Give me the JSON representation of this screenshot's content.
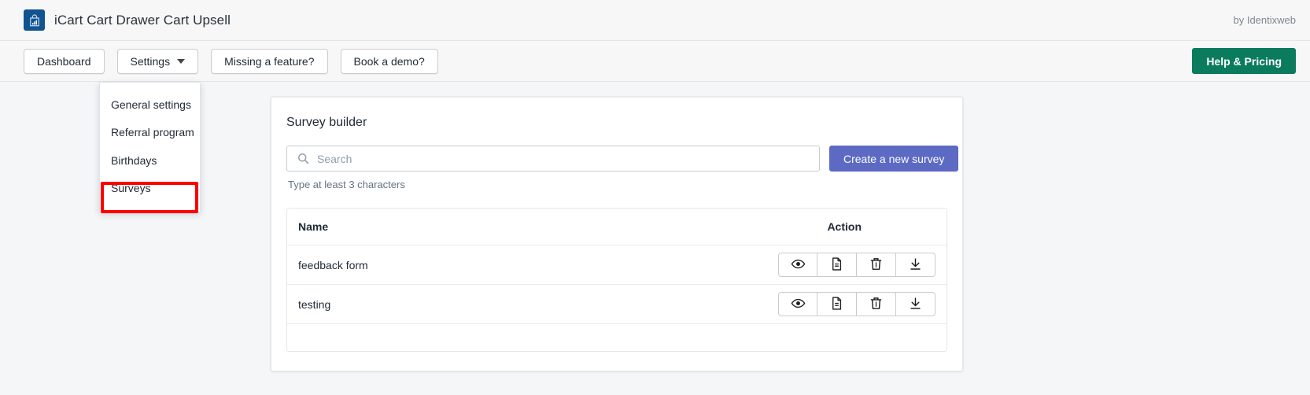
{
  "appbar": {
    "logo_icon": "shopping-bag-chart-icon",
    "title": "iCart Cart Drawer Cart Upsell",
    "vendor": "by Identixweb"
  },
  "toolbar": {
    "dashboard_label": "Dashboard",
    "settings_label": "Settings",
    "settings_caret_icon": "chevron-down-icon",
    "missing_feature_label": "Missing a feature?",
    "book_demo_label": "Book a demo?",
    "help_pricing_label": "Help & Pricing",
    "help_pricing_color": "#0b7b5e"
  },
  "settings_menu": {
    "items": [
      {
        "label": "General settings"
      },
      {
        "label": "Referral program"
      },
      {
        "label": "Birthdays"
      },
      {
        "label": "Surveys"
      }
    ],
    "highlighted_item": "Surveys",
    "highlight_color": "#ff0000"
  },
  "card": {
    "title": "Survey builder",
    "search": {
      "icon": "search-icon",
      "placeholder": "Search",
      "value": "",
      "helper_text": "Type at least 3 characters"
    },
    "create_button": {
      "label": "Create a new survey",
      "color": "#5c6ac4"
    },
    "table": {
      "columns": [
        "Name",
        "Action"
      ],
      "rows": [
        {
          "name": "feedback form",
          "actions": [
            "eye-icon",
            "document-icon",
            "trash-icon",
            "download-icon"
          ]
        },
        {
          "name": "testing",
          "actions": [
            "eye-icon",
            "document-icon",
            "trash-icon",
            "download-icon"
          ]
        }
      ],
      "action_titles": [
        "View",
        "Report",
        "Delete",
        "Download"
      ]
    }
  }
}
